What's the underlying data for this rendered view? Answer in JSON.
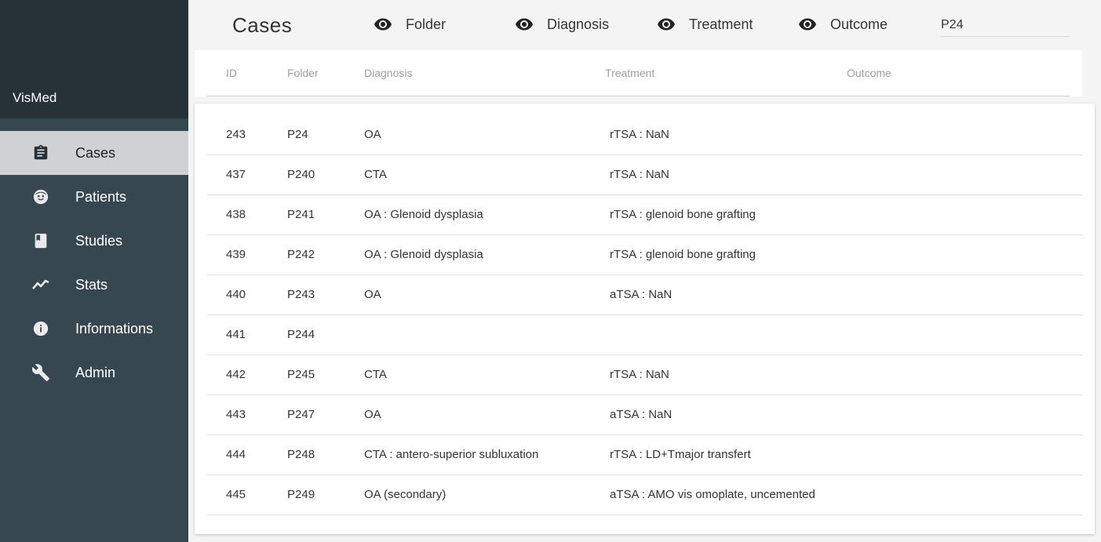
{
  "app": {
    "name": "VisMed"
  },
  "sidebar": {
    "items": [
      {
        "label": "Cases",
        "icon": "clipboard-icon",
        "active": true
      },
      {
        "label": "Patients",
        "icon": "face-icon",
        "active": false
      },
      {
        "label": "Studies",
        "icon": "book-icon",
        "active": false
      },
      {
        "label": "Stats",
        "icon": "trending-up-icon",
        "active": false
      },
      {
        "label": "Informations",
        "icon": "info-icon",
        "active": false
      },
      {
        "label": "Admin",
        "icon": "wrench-icon",
        "active": false
      }
    ]
  },
  "header": {
    "title": "Cases",
    "toggles": [
      {
        "label": "Folder",
        "icon": "eye-icon"
      },
      {
        "label": "Diagnosis",
        "icon": "eye-icon"
      },
      {
        "label": "Treatment",
        "icon": "eye-icon"
      },
      {
        "label": "Outcome",
        "icon": "eye-icon"
      }
    ],
    "search": {
      "value": "P24"
    }
  },
  "table": {
    "columns": [
      "ID",
      "Folder",
      "Diagnosis",
      "Treatment",
      "Outcome"
    ],
    "rows": [
      {
        "id": "243",
        "folder": "P24",
        "diagnosis": "OA",
        "treatment": "rTSA : NaN",
        "outcome": ""
      },
      {
        "id": "437",
        "folder": "P240",
        "diagnosis": "CTA",
        "treatment": "rTSA : NaN",
        "outcome": ""
      },
      {
        "id": "438",
        "folder": "P241",
        "diagnosis": "OA : Glenoid dysplasia",
        "treatment": "rTSA : glenoid bone grafting",
        "outcome": ""
      },
      {
        "id": "439",
        "folder": "P242",
        "diagnosis": "OA : Glenoid dysplasia",
        "treatment": "rTSA : glenoid bone grafting",
        "outcome": ""
      },
      {
        "id": "440",
        "folder": "P243",
        "diagnosis": "OA",
        "treatment": "aTSA : NaN",
        "outcome": ""
      },
      {
        "id": "441",
        "folder": "P244",
        "diagnosis": "",
        "treatment": "",
        "outcome": ""
      },
      {
        "id": "442",
        "folder": "P245",
        "diagnosis": "CTA",
        "treatment": "rTSA : NaN",
        "outcome": ""
      },
      {
        "id": "443",
        "folder": "P247",
        "diagnosis": "OA",
        "treatment": "aTSA : NaN",
        "outcome": ""
      },
      {
        "id": "444",
        "folder": "P248",
        "diagnosis": "CTA : antero-superior subluxation",
        "treatment": "rTSA : LD+Tmajor transfert",
        "outcome": ""
      },
      {
        "id": "445",
        "folder": "P249",
        "diagnosis": "OA (secondary)",
        "treatment": "aTSA : AMO vis omoplate, uncemented",
        "outcome": ""
      }
    ]
  },
  "colors": {
    "sidebar_bg": "#37474f",
    "sidebar_header_bg": "#263238",
    "active_item_bg": "#cfd1d2",
    "page_bg": "#f4f4f4"
  }
}
